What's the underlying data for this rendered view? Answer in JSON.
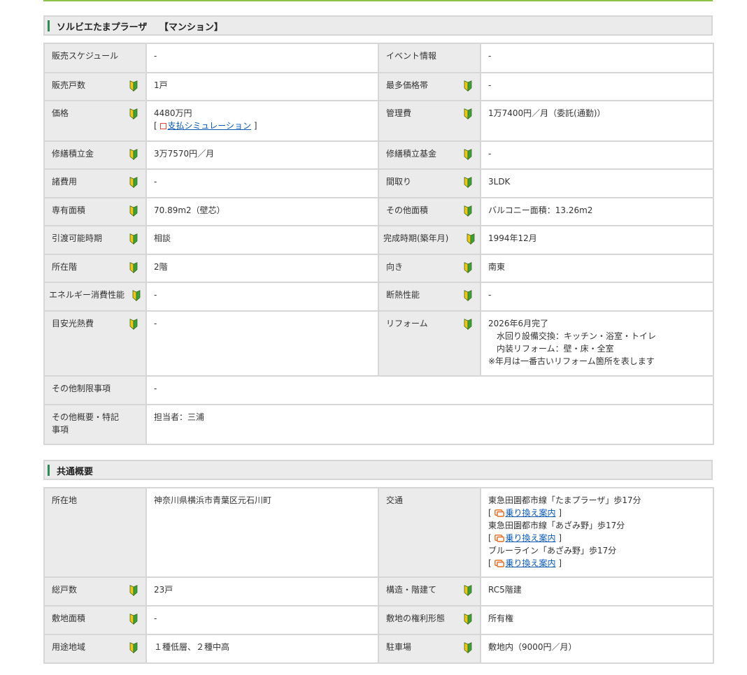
{
  "colors": {
    "accent_green": "#8bc34a",
    "label_bg": "#ebebeb",
    "border": "#d6d6d6",
    "link": "#0b59b4"
  },
  "icons": {
    "beginner": "beginner-mark-icon",
    "square": "red-square-icon",
    "train": "train-icon"
  },
  "section1": {
    "title": "ソルビエたまプラーザ　 【マンション】",
    "sales_schedule": {
      "label": "販売スケジュール",
      "value": "-"
    },
    "event_info": {
      "label": "イベント情報",
      "value": "-"
    },
    "units_for_sale": {
      "label": "販売戸数",
      "value": "1戸"
    },
    "most_price_range": {
      "label": "最多価格帯",
      "value": "-"
    },
    "price": {
      "label": "価格",
      "value": "4480万円",
      "bracket_open": "[",
      "link": "支払シミュレーション",
      "bracket_close": "]"
    },
    "management_fee": {
      "label": "管理費",
      "value": "1万7400円／月（委託(通勤)）"
    },
    "repair_reserve": {
      "label": "修繕積立金",
      "value": "3万7570円／月"
    },
    "repair_fund": {
      "label": "修繕積立基金",
      "value": "-"
    },
    "misc_costs": {
      "label": "諸費用",
      "value": "-"
    },
    "floor_plan": {
      "label": "間取り",
      "value": "3LDK"
    },
    "exclusive_area": {
      "label": "専有面積",
      "value": "70.89m2（壁芯）"
    },
    "other_area": {
      "label": "その他面積",
      "value": "バルコニー面積：13.26m2"
    },
    "handover": {
      "label": "引渡可能時期",
      "value": "相談"
    },
    "completion": {
      "label": "完成時期(築年月)",
      "value": "1994年12月"
    },
    "floor": {
      "label": "所在階",
      "value": "2階"
    },
    "direction": {
      "label": "向き",
      "value": "南東"
    },
    "energy": {
      "label": "エネルギー消費性能",
      "value": "-"
    },
    "insulation": {
      "label": "断熱性能",
      "value": "-"
    },
    "utility_cost": {
      "label": "目安光熱費",
      "value": "-"
    },
    "reform": {
      "label": "リフォーム",
      "line1": "2026年6月完了",
      "line2": "水回り設備交換：キッチン・浴室・トイレ",
      "line3": "内装リフォーム：壁・床・全室",
      "line4": "※年月は一番古いリフォーム箇所を表します"
    },
    "other_restrictions": {
      "label": "その他制限事項",
      "value": "-"
    },
    "other_notes": {
      "label": "その他概要・特記事項",
      "value": "担当者：三浦"
    }
  },
  "section2": {
    "title": "共通概要",
    "location": {
      "label": "所在地",
      "value": "神奈川県横浜市青葉区元石川町"
    },
    "transport": {
      "label": "交通",
      "bracket_open": "[",
      "bracket_close": "]",
      "route1": "東急田園都市線「たまプラーザ」歩17分",
      "route2": "東急田園都市線「あざみ野」歩17分",
      "route3": "ブルーライン「あざみ野」歩17分",
      "link": "乗り換え案内"
    },
    "total_units": {
      "label": "総戸数",
      "value": "23戸"
    },
    "structure": {
      "label": "構造・階建て",
      "value": "RC5階建"
    },
    "land_area": {
      "label": "敷地面積",
      "value": "-"
    },
    "land_rights": {
      "label": "敷地の権利形態",
      "value": "所有権"
    },
    "zoning": {
      "label": "用途地域",
      "value": "１種低層、２種中高"
    },
    "parking": {
      "label": "駐車場",
      "value": "敷地内（9000円／月）"
    }
  }
}
